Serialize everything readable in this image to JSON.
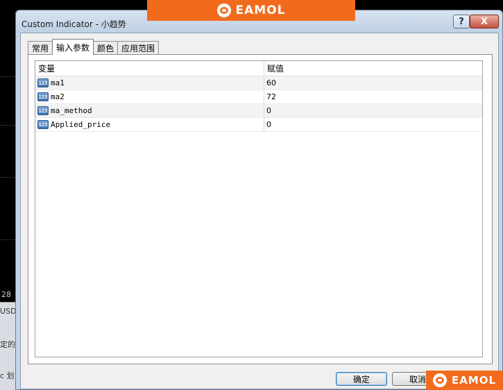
{
  "background": {
    "axis_labels": [
      "28",
      "USD"
    ],
    "panel_labels": [
      "定的",
      "c 划"
    ]
  },
  "window": {
    "title": "Custom Indicator - 小趋势",
    "help_label": "?",
    "close_label": "X"
  },
  "tabs": [
    {
      "label": "常用",
      "active": false
    },
    {
      "label": "输入参数",
      "active": true
    },
    {
      "label": "颜色",
      "active": false
    },
    {
      "label": "应用范围",
      "active": false
    }
  ],
  "table": {
    "headers": {
      "variable": "变量",
      "value": "赋值"
    },
    "type_icon_label": "123",
    "rows": [
      {
        "name": "ma1",
        "value": "60"
      },
      {
        "name": "ma2",
        "value": "72"
      },
      {
        "name": "ma_method",
        "value": "0"
      },
      {
        "name": "Applied_price",
        "value": "0"
      }
    ]
  },
  "buttons": {
    "ok": "确定",
    "cancel": "取消"
  },
  "watermark": {
    "text": "EAMOL"
  },
  "colors": {
    "watermark": "#f26b1d",
    "window_frame": "#c5d4e6"
  }
}
